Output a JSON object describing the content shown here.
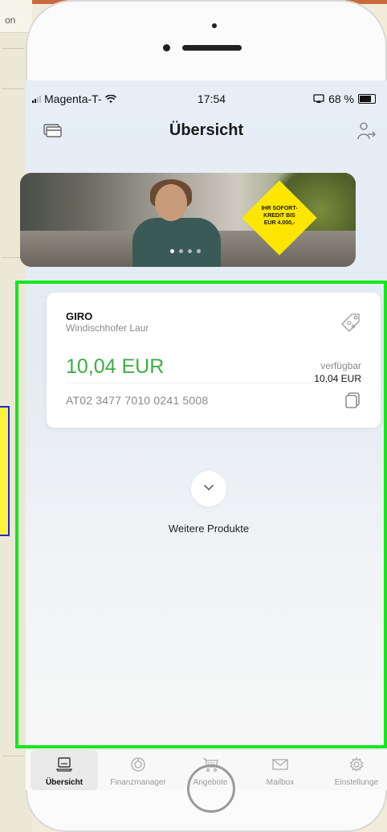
{
  "background": {
    "tab_text": "on"
  },
  "status_bar": {
    "carrier": "Magenta-T-",
    "time": "17:54",
    "battery": "68 %"
  },
  "header": {
    "title": "Übersicht"
  },
  "banner": {
    "badge_text": "IHR SOFORT-\nKREDIT BIS\nEUR 4.000,-"
  },
  "account": {
    "type": "GIRO",
    "holder": "Windischhofer Laur",
    "balance": "10,04 EUR",
    "available_label": "verfügbar",
    "available_value": "10,04 EUR",
    "iban": "AT02 3477 7010 0241 5008"
  },
  "more_products": {
    "label": "Weitere Produkte"
  },
  "tabbar": {
    "items": [
      {
        "label": "Übersicht",
        "icon": "laptop-icon",
        "active": true
      },
      {
        "label": "Finanzmanager",
        "icon": "chart-ring-icon",
        "active": false
      },
      {
        "label": "Angebote",
        "icon": "cart-icon",
        "active": false
      },
      {
        "label": "Mailbox",
        "icon": "envelope-icon",
        "active": false
      },
      {
        "label": "Einstellunge",
        "icon": "gear-icon",
        "active": false
      }
    ]
  },
  "colors": {
    "accent_green": "#3dae45",
    "highlight": "#13e81d",
    "badge": "#ffe600"
  }
}
